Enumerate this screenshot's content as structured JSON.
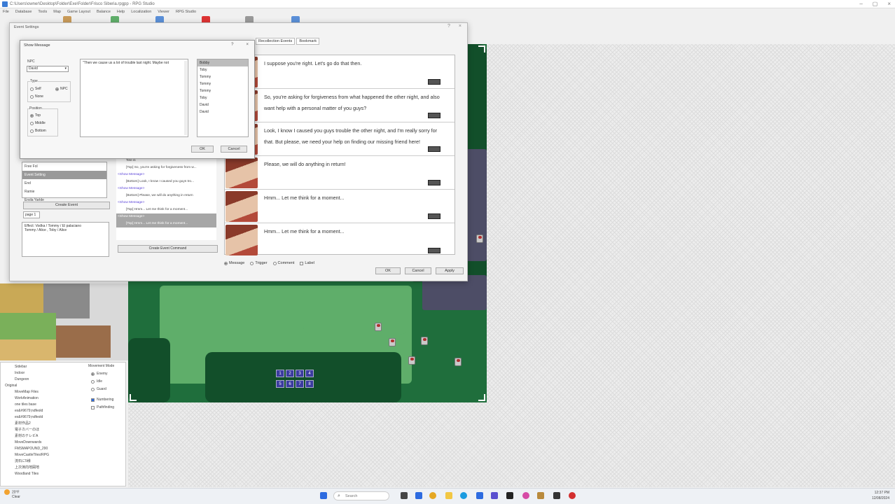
{
  "window": {
    "title": "C:\\Users\\owner\\Desktop\\Folder\\Exe\\Folder\\Frisco Siberia.rpgpp - RPG Studio"
  },
  "menu": [
    "File",
    "Database",
    "Tools",
    "Map",
    "Game Layout",
    "Balance",
    "Help",
    "Localization",
    "Viewer",
    "RPG Studio"
  ],
  "event_window": {
    "title": "Event Settings",
    "page_tabs": [
      "Recollection Events",
      "Bookmark"
    ],
    "event_list": [
      "Free Fol",
      "Event Setting",
      "End",
      "Ramie",
      "Ersila Yarlde"
    ],
    "event_list_selected": 1,
    "create_event": "Create Event",
    "page_field": "page 1",
    "notes": "Effect: Vodka / Tommy / El palaciano\nTommy / Alice , Toby / Alice",
    "commands": [
      {
        "kind": "line",
        "text": "Tele iti"
      },
      {
        "kind": "line",
        "text": "[Top] So, you're asking for forgiveness from w..."
      },
      {
        "kind": "head",
        "text": "<Show Message>"
      },
      {
        "kind": "line",
        "text": "[Bottom] Look, I know I caused you guys tro..."
      },
      {
        "kind": "head",
        "text": "<Show Message>"
      },
      {
        "kind": "line",
        "text": "[Bottom] Please, we will do anything in return"
      },
      {
        "kind": "head",
        "text": "<Show Message>"
      },
      {
        "kind": "line",
        "text": "[Top] Hmm... Let me think for a moment..."
      },
      {
        "kind": "head",
        "text": "<Show Message>",
        "selected": true
      },
      {
        "kind": "line",
        "text": "[Top] Hmm... Let me think for a moment...",
        "selected": true
      }
    ],
    "create_event_command": "Create Event Command",
    "messages": [
      {
        "text": "I suppose you're right. Let's go do that then."
      },
      {
        "text": "So, you're asking for forgiveness from what happened the other night, and also want help with a personal matter of you guys?"
      },
      {
        "text": "Look, I know I caused you guys trouble the other night, and I'm really sorry for that. But please, we need your help on finding our missing friend here!"
      },
      {
        "text": "Please, we will do anything in return!"
      },
      {
        "text": "Hmm... Let me think for a moment..."
      },
      {
        "text": "Hmm... Let me think for a moment..."
      }
    ],
    "modes": [
      "Message",
      "Trigger",
      "Comment",
      "Label"
    ],
    "buttons": {
      "ok": "OK",
      "cancel": "Cancel",
      "apply": "Apply"
    }
  },
  "show_message": {
    "title": "Show Message",
    "help": "?",
    "close": "×",
    "npc_label": "NPC",
    "npc_value": "David",
    "type_label": "Type",
    "type_options": [
      "Self",
      "NPC",
      "None"
    ],
    "position_label": "Position",
    "position_options": [
      "Top",
      "Middle",
      "Bottom"
    ],
    "text": "\"Then we cause us a lot of trouble last night. Maybe not",
    "names": [
      "Bobby",
      "Toby",
      "Tommy",
      "Tommy",
      "Tommy",
      "Toby",
      "David",
      "David"
    ],
    "names_selected": 0,
    "ok": "OK",
    "cancel": "Cancel"
  },
  "tree": [
    "Sidebar",
    "Indoor",
    "Dungeon",
    "Original",
    "MoveMap Files",
    "WorkAnimation",
    "one tiles base",
    "ex&#9679;ndfeold",
    "ex&#9679;ndfeold",
    "素材作品2",
    "電子カバーのほ",
    "素材のテレビA",
    "MoveDownwards",
    "FMSMAPOUND_290",
    "MoveCastleTiles/RPG",
    "流石に5様",
    "上次演向地図地",
    "Woodland Tiles"
  ],
  "motion": {
    "label": "Movement Mode",
    "options": [
      "Enemy",
      "Idle",
      "Guard"
    ],
    "numbering": "Numbering",
    "pathfinding": "Pathfinding"
  },
  "palette": [
    1,
    2,
    3,
    4,
    5,
    6,
    7,
    8
  ],
  "taskbar": {
    "temp": "20°F",
    "weather": "Clear",
    "search": "Search",
    "time": "12:37 PM",
    "date": "12/08/2024"
  },
  "colors": {
    "accent": "#3a7bd5",
    "grass": "#5fae6a",
    "forest": "#1f6e3c",
    "message_link": "#5b44d8"
  }
}
